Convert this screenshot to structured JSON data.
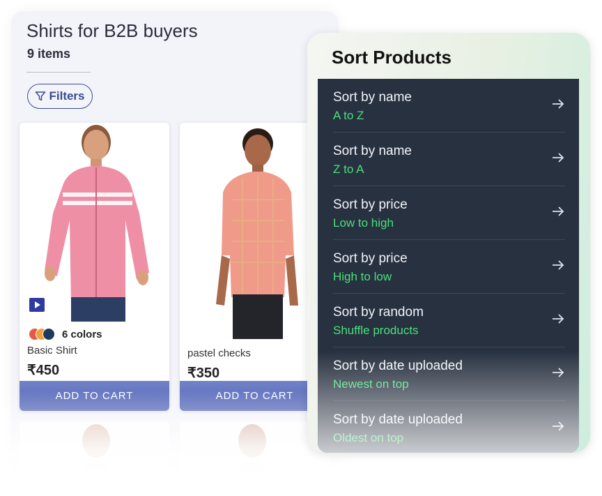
{
  "catalog": {
    "title": "Shirts for B2B buyers",
    "count": "9 items",
    "filters_label": "Filters",
    "products": [
      {
        "name": "Basic Shirt",
        "price": "₹450",
        "colors_label": "6 colors",
        "swatch_colors": [
          "#e8584a",
          "#f2a23c",
          "#1e3a5f"
        ],
        "has_video": true,
        "cart_label": "ADD TO CART"
      },
      {
        "name": "pastel checks",
        "price": "₹350",
        "cart_label": "ADD TO CART"
      }
    ]
  },
  "sort_panel": {
    "title": "Sort Products",
    "options": [
      {
        "label": "Sort by name",
        "sub": "A to Z",
        "icon": "arrow-right-icon"
      },
      {
        "label": "Sort by name",
        "sub": "Z to A",
        "icon": "arrow-right-icon"
      },
      {
        "label": "Sort by price",
        "sub": "Low to high",
        "icon": "arrow-right-icon"
      },
      {
        "label": "Sort by price",
        "sub": "High to low",
        "icon": "arrow-right-icon"
      },
      {
        "label": "Sort by random",
        "sub": "Shuffle products",
        "icon": "arrow-right-icon"
      },
      {
        "label": "Sort by date uploaded",
        "sub": "Newest on top",
        "icon": "arrow-right-icon"
      },
      {
        "label": "Sort by date uploaded",
        "sub": "Oldest on top",
        "icon": "arrow-right-icon"
      }
    ]
  },
  "colors": {
    "accent_green": "#49e07d",
    "panel_dark": "#283140",
    "button_blue": "#5264b6"
  }
}
